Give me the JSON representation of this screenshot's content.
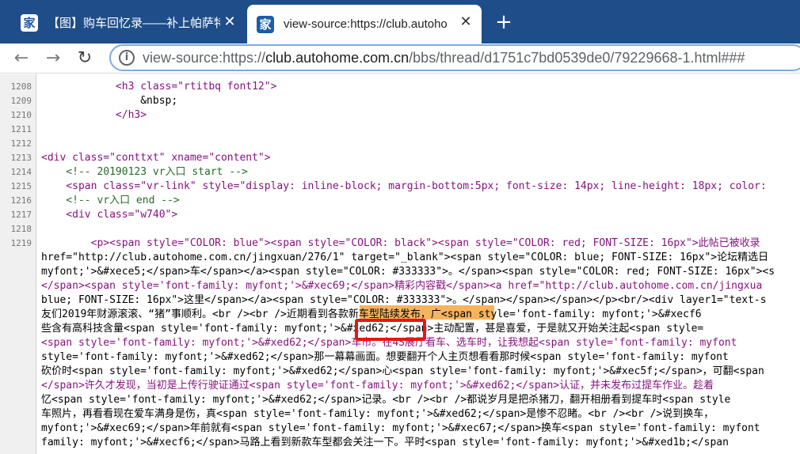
{
  "tabs": [
    {
      "favicon": "家",
      "title": "【图】购车回忆录——补上帕萨特",
      "close": "✕"
    },
    {
      "favicon": "家",
      "title": "view-source:https://club.autoho",
      "close": "✕"
    }
  ],
  "new_tab": "+",
  "toolbar": {
    "back": "←",
    "forward": "→",
    "reload": "↻",
    "info": "i",
    "url_prefix": "view-source:https://",
    "url_host": "club.autohome.com.cn",
    "url_path": "/bbs/thread/d1751c7bd0539de0/79229668-1.html###"
  },
  "lines": [
    {
      "n": "1208",
      "text": "            <h3 class=\"rtitbq font12\">"
    },
    {
      "n": "1209",
      "text": "                &nbsp;"
    },
    {
      "n": "1210",
      "text": "            </h3>"
    },
    {
      "n": "1211",
      "text": ""
    },
    {
      "n": "1212",
      "text": ""
    },
    {
      "n": "1213",
      "text": "<div class=\"conttxt\" xname=\"content\">"
    },
    {
      "n": "1214",
      "text": "    <!-- 20190123 vr入口 start -->"
    },
    {
      "n": "1215",
      "text": "    <span class=\"vr-link\" style=\"display: inline-block; margin-bottom:5px; font-size: 14px; line-height: 18px; color:"
    },
    {
      "n": "1216",
      "text": "    <!-- vr入口 end -->"
    },
    {
      "n": "1217",
      "text": "    <div class=\"w740\">"
    },
    {
      "n": "1218",
      "text": ""
    },
    {
      "n": "1219",
      "text": "        <p><span style=\"COLOR: blue\"><span style=\"COLOR: black\"><span style=\"COLOR: red; FONT-SIZE: 16px\">此帖已被收录"
    },
    {
      "n": "",
      "text": "href=\"http://club.autohome.com.cn/jingxuan/276/1\" target=\"_blank\"><span style=\"COLOR: blue; FONT-SIZE: 16px\">论坛精选日"
    },
    {
      "n": "",
      "text": "myfont;'>&#xece5;</span>车</span></a><span style=\"COLOR: #333333\">。</span><span style=\"COLOR: red; FONT-SIZE: 16px\"><s"
    },
    {
      "n": "",
      "text": "</span><span style='font-family: myfont;'>&#xec69;</span>精彩内容戳</span><a href=\"http://club.autohome.com.cn/jingxua"
    },
    {
      "n": "",
      "text": "blue; FONT-SIZE: 16px\">这里</span></a><span style=\"COLOR: #333333\">。</span></span></span></p><br/><div layer1=\"text-s"
    },
    {
      "n": "",
      "text": "友们2019年财源滚滚、“猪”事顺利。<br /><br />近期看到各款新车型陆续发布，广<span style='font-family: myfont;'>&#xecf6"
    },
    {
      "n": "",
      "text": "些含有高科技含量<span style='font-family: myfont;'>&#xed62;</span>主动配置，甚是喜爱，于是就又开始关注起<span style="
    },
    {
      "n": "",
      "text": "<span style='font-family: myfont;'>&#xed62;</span>车市。在4S展厅看车、选车时，让我想起<span style='font-family: myfont"
    },
    {
      "n": "",
      "text": "style='font-family: myfont;'>&#xed62;</span>那一幕幕画面。想要翻开个人主页想看看那时候<span style='font-family: myfont"
    },
    {
      "n": "",
      "text": "砍价时<span style='font-family: myfont;'>&#xed62;</span>心<span style='font-family: myfont;'>&#xec5f;</span>，可翻<span"
    },
    {
      "n": "",
      "text": "</span>许久才发现，当初是上传行驶证通过<span style='font-family: myfont;'>&#xed62;</span>认证，并未发布过提车作业。趁着"
    },
    {
      "n": "",
      "text": "忆<span style='font-family: myfont;'>&#xed62;</span>记录。<br /><br />都说岁月是把杀猪刀，翻开相册看到提车时<span style"
    },
    {
      "n": "",
      "text": "车照片，再看看现在爱车满身是伤，真<span style='font-family: myfont;'>&#xed62;</span>是惨不忍睹。<br /><br />说到换车，"
    },
    {
      "n": "",
      "text": "myfont;'>&#xec69;</span>年前就有<span style='font-family: myfont;'>&#xec67;</span>换车<span style='font-family: myfont"
    },
    {
      "n": "",
      "text": "family: myfont;'>&#xecf6;</span>马路上看到新款车型都会关注一下。平时<span style='font-family: myfont;'>&#xed1b;</span"
    }
  ]
}
